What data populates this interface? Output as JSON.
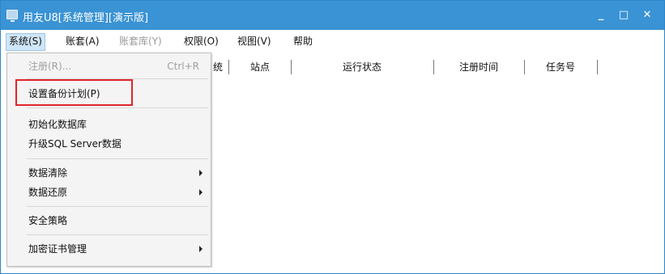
{
  "window": {
    "title": "用友U8[系统管理][演示版]",
    "min": "_",
    "max": "□",
    "close": "✕"
  },
  "menubar": [
    {
      "label": "系统(S)"
    },
    {
      "label": "账套(A)"
    },
    {
      "label": "账套库(Y)"
    },
    {
      "label": "权限(O)"
    },
    {
      "label": "视图(V)"
    },
    {
      "label": "帮助"
    }
  ],
  "table": {
    "columns": [
      "统",
      "站点",
      "运行状态",
      "注册时间",
      "任务号"
    ]
  },
  "system_menu": [
    {
      "label": "注册(R)...",
      "shortcut": "Ctrl+R",
      "disabled": true
    },
    {
      "label": "设置备份计划(P)"
    },
    {
      "label": "初始化数据库"
    },
    {
      "label": "升级SQL Server数据"
    },
    {
      "label": "数据清除"
    },
    {
      "label": "数据还原"
    },
    {
      "label": "安全策略"
    },
    {
      "label": "加密证书管理"
    }
  ],
  "colors": {
    "titlebar": "#3a93d4",
    "highlight": "#e0242a"
  }
}
